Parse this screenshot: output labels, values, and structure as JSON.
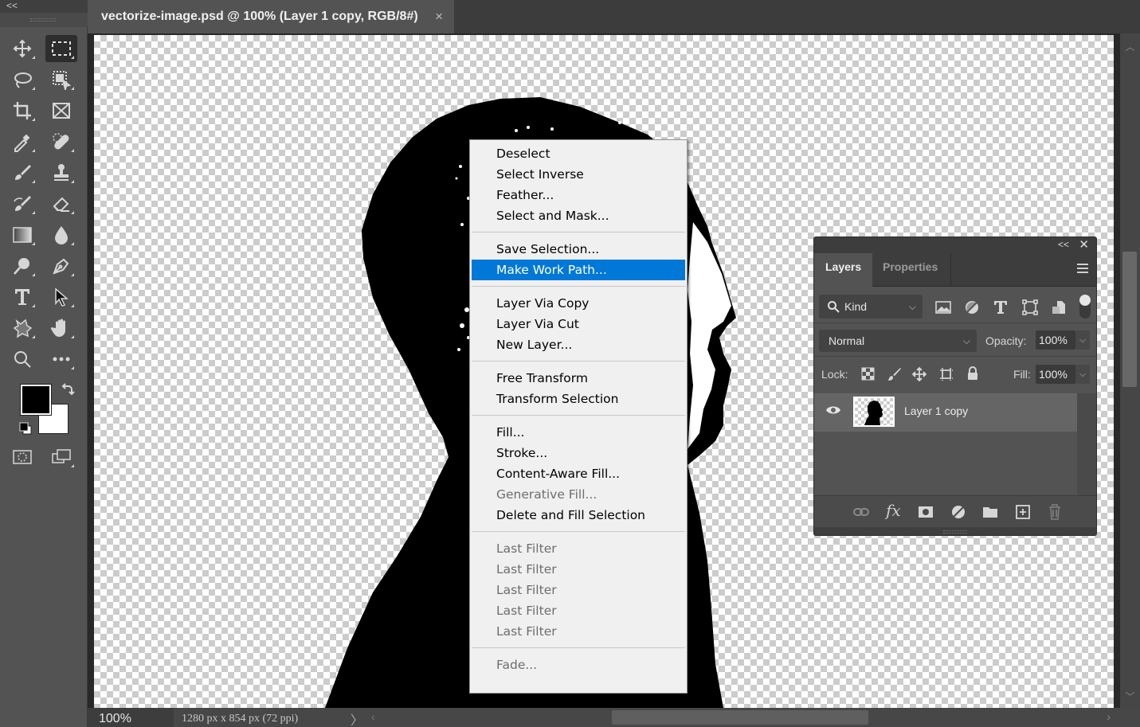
{
  "toolbar": {
    "collapse_label": "<<",
    "tools": [
      {
        "name": "move-tool",
        "icon": "move-icon",
        "active": false
      },
      {
        "name": "rectangular-marquee-tool",
        "icon": "marquee-icon",
        "active": true
      },
      {
        "name": "lasso-tool",
        "icon": "lasso-icon",
        "active": false
      },
      {
        "name": "object-selection-tool",
        "icon": "object-selection-icon",
        "active": false
      },
      {
        "name": "crop-tool",
        "icon": "crop-icon",
        "active": false
      },
      {
        "name": "frame-tool",
        "icon": "frame-icon",
        "active": false
      },
      {
        "name": "eyedropper-tool",
        "icon": "eyedropper-icon",
        "active": false
      },
      {
        "name": "healing-brush-tool",
        "icon": "bandage-icon",
        "active": false
      },
      {
        "name": "brush-tool",
        "icon": "brush-icon",
        "active": false
      },
      {
        "name": "clone-stamp-tool",
        "icon": "stamp-icon",
        "active": false
      },
      {
        "name": "history-brush-tool",
        "icon": "history-brush-icon",
        "active": false
      },
      {
        "name": "eraser-tool",
        "icon": "eraser-icon",
        "active": false
      },
      {
        "name": "gradient-tool",
        "icon": "gradient-icon",
        "active": false
      },
      {
        "name": "blur-tool",
        "icon": "drop-icon",
        "active": false
      },
      {
        "name": "dodge-tool",
        "icon": "dodge-icon",
        "active": false
      },
      {
        "name": "pen-tool",
        "icon": "pen-icon",
        "active": false
      },
      {
        "name": "type-tool",
        "icon": "type-icon",
        "active": false
      },
      {
        "name": "path-selection-tool",
        "icon": "arrow-icon",
        "active": false
      },
      {
        "name": "custom-shape-tool",
        "icon": "shape-icon",
        "active": false
      },
      {
        "name": "hand-tool",
        "icon": "hand-icon",
        "active": false
      },
      {
        "name": "zoom-tool",
        "icon": "magnifier-icon",
        "active": false
      },
      {
        "name": "more-tools",
        "icon": "ellipsis-icon",
        "active": false
      }
    ],
    "foreground_color": "#000000",
    "background_color": "#ffffff"
  },
  "document": {
    "tab_title": "vectorize-image.psd @ 100% (Layer 1 copy, RGB/8#)",
    "close_glyph": "×"
  },
  "status": {
    "zoom": "100%",
    "doc_info": "1280 px x 854 px (72 ppi)",
    "arrow": "〉"
  },
  "context_menu": {
    "groups": [
      [
        {
          "label": "Deselect",
          "enabled": true
        },
        {
          "label": "Select Inverse",
          "enabled": true
        },
        {
          "label": "Feather...",
          "enabled": true
        },
        {
          "label": "Select and Mask...",
          "enabled": true
        }
      ],
      [
        {
          "label": "Save Selection...",
          "enabled": true
        },
        {
          "label": "Make Work Path...",
          "enabled": true,
          "highlighted": true
        }
      ],
      [
        {
          "label": "Layer Via Copy",
          "enabled": true
        },
        {
          "label": "Layer Via Cut",
          "enabled": true
        },
        {
          "label": "New Layer...",
          "enabled": true
        }
      ],
      [
        {
          "label": "Free Transform",
          "enabled": true
        },
        {
          "label": "Transform Selection",
          "enabled": true
        }
      ],
      [
        {
          "label": "Fill...",
          "enabled": true
        },
        {
          "label": "Stroke...",
          "enabled": true
        },
        {
          "label": "Content-Aware Fill...",
          "enabled": true
        },
        {
          "label": "Generative Fill...",
          "enabled": false
        },
        {
          "label": "Delete and Fill Selection",
          "enabled": true
        }
      ],
      [
        {
          "label": "Last Filter",
          "enabled": false
        },
        {
          "label": "Last Filter",
          "enabled": false
        },
        {
          "label": "Last Filter",
          "enabled": false
        },
        {
          "label": "Last Filter",
          "enabled": false
        },
        {
          "label": "Last Filter",
          "enabled": false
        }
      ],
      [
        {
          "label": "Fade...",
          "enabled": false
        }
      ]
    ],
    "highlight_color": "#0078d7"
  },
  "layers_panel": {
    "collapse_glyph": "<<",
    "close_glyph": "✕",
    "tabs": [
      {
        "label": "Layers",
        "active": true
      },
      {
        "label": "Properties",
        "active": false
      }
    ],
    "filter": {
      "label": "Kind"
    },
    "blend_mode": "Normal",
    "opacity_label": "Opacity:",
    "opacity_value": "100%",
    "lock_label": "Lock:",
    "fill_label": "Fill:",
    "fill_value": "100%",
    "layers": [
      {
        "name": "Layer 1 copy",
        "visible": true,
        "selected": true
      }
    ]
  }
}
